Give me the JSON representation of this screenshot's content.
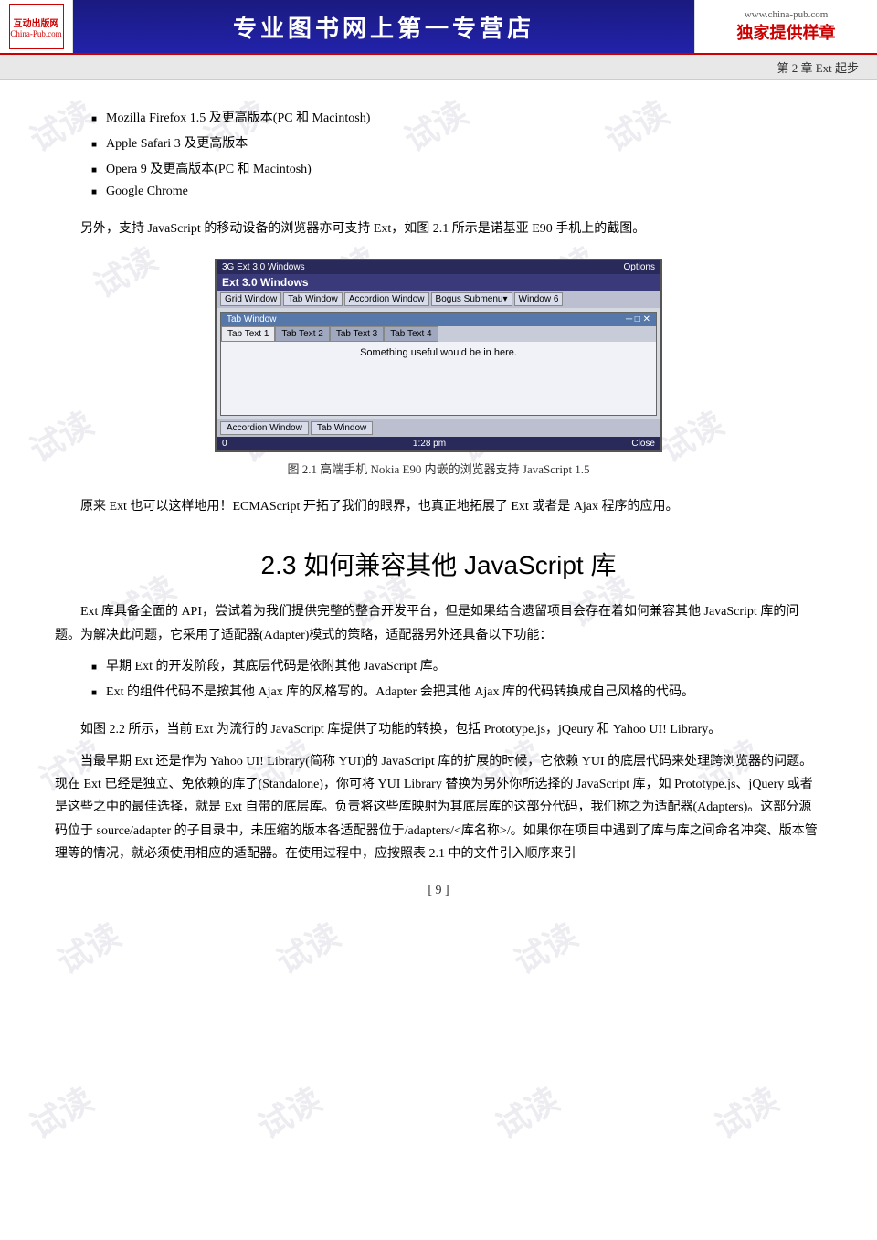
{
  "header": {
    "logo_line1": "互动出版网",
    "logo_line2": "China-Pub.com",
    "title": "专业图书网上第一专营店",
    "url": "www.china-pub.com",
    "label": "独家提供样章"
  },
  "chapter_bar": {
    "text": "第 2 章   Ext 起步"
  },
  "bullet_items": [
    "Mozilla Firefox 1.5 及更高版本(PC 和 Macintosh)",
    "Apple Safari 3 及更高版本",
    "Opera 9 及更高版本(PC 和 Macintosh)",
    "Google Chrome"
  ],
  "intro_para": "另外，支持 JavaScript 的移动设备的浏览器亦可支持 Ext，如图 2.1 所示是诺基亚 E90 手机上的截图。",
  "figure": {
    "status_bar_left": "3G  Ext 3.0 Windows",
    "status_bar_right": "Options",
    "title_bar": "Ext 3.0 Windows",
    "menu_items": [
      "Grid Window",
      "Tab Window",
      "Accordion Window",
      "Bogus Submenu▾",
      "Window 6"
    ],
    "window_title": "Tab Window",
    "window_controls": "─ □ ✕",
    "tabs": [
      "Tab Text 1",
      "Tab Text 2",
      "Tab Text 3",
      "Tab Text 4"
    ],
    "content_text": "Something useful would be in here.",
    "bottom_bar_left": "Accordion Window",
    "bottom_bar_right": "Tab Window",
    "footer_left": "0",
    "footer_center": "1:28 pm",
    "footer_right": "Close",
    "caption": "图 2.1    高端手机 Nokia E90 内嵌的浏览器支持 JavaScript 1.5"
  },
  "para1": "原来 Ext 也可以这样地用！ECMAScript 开拓了我们的眼界，也真正地拓展了 Ext 或者是 Ajax 程序的应用。",
  "section_title": "2.3   如何兼容其他 JavaScript 库",
  "para2": "Ext 库具备全面的 API，尝试着为我们提供完整的整合开发平台，但是如果结合遗留项目会存在着如何兼容其他 JavaScript 库的问题。为解决此问题，它采用了适配器(Adapter)模式的策略，适配器另外还具备以下功能：",
  "bullet2_items": [
    "早期 Ext 的开发阶段，其底层代码是依附其他 JavaScript 库。",
    "Ext 的组件代码不是按其他 Ajax 库的风格写的。Adapter 会把其他 Ajax 库的代码转换成自己风格的代码。"
  ],
  "para3": "如图 2.2 所示，当前 Ext 为流行的 JavaScript 库提供了功能的转换，包括 Prototype.js，jQeury 和 Yahoo UI! Library。",
  "para4": "当最早期 Ext 还是作为 Yahoo UI! Library(简称 YUI)的 JavaScript 库的扩展的时候，它依赖 YUI 的底层代码来处理跨浏览器的问题。现在 Ext 已经是独立、免依赖的库了(Standalone)，你可将 YUI  Library 替换为另外你所选择的 JavaScript 库，如 Prototype.js、jQuery 或者是这些之中的最佳选择，就是 Ext 自带的底层库。负责将这些库映射为其底层库的这部分代码，我们称之为适配器(Adapters)。这部分源码位于 source/adapter 的子目录中，未压缩的版本各适配器位于/adapters/<库名称>/。如果你在项目中遇到了库与库之间命名冲突、版本管理等的情况，就必须使用相应的适配器。在使用过程中，应按照表 2.1 中的文件引入顺序来引",
  "page_number": "[ 9 ]",
  "watermarks": [
    "试读",
    "试读",
    "试读",
    "试读",
    "试读",
    "试读",
    "试读",
    "试读",
    "试读",
    "试读",
    "试读",
    "试读"
  ]
}
